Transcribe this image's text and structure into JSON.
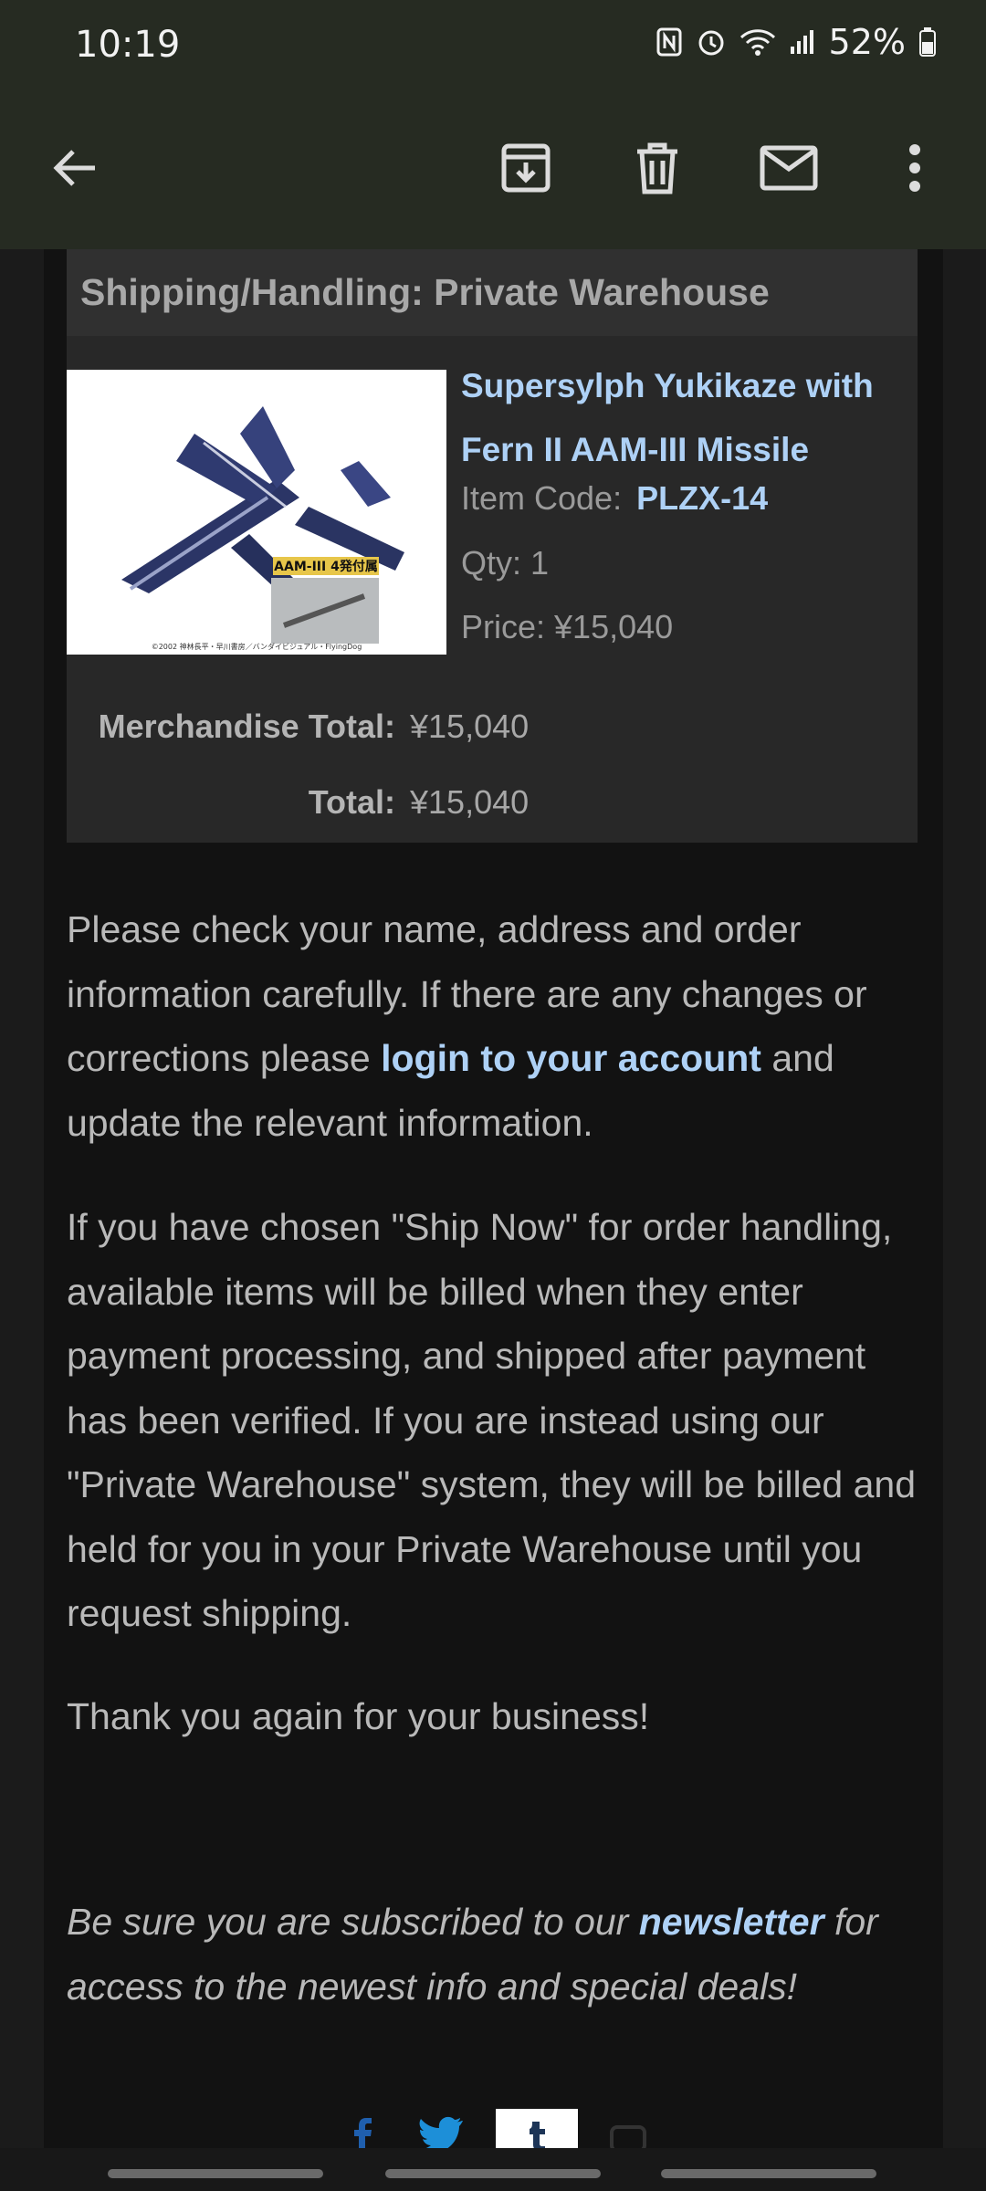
{
  "status": {
    "time": "10:19",
    "battery": "52%"
  },
  "toolbar": {
    "back_icon": "arrow-left-icon",
    "archive_icon": "archive-icon",
    "delete_icon": "trash-icon",
    "mail_icon": "mail-icon",
    "more_icon": "more-vert-icon"
  },
  "order": {
    "shipping_header": "Shipping/Handling: Private Warehouse",
    "product": {
      "name": "Supersylph Yukikaze with Fern II AAM-III Missile",
      "code_label": "Item Code:",
      "code": "PLZX-14",
      "qty": "Qty: 1",
      "price": "Price: ¥15,040",
      "image_badge": "AAM-III 4発付属",
      "image_caption": "©2002 神林長平・早川書房／バンダイビジュアル・FlyingDog"
    },
    "merch_total_label": "Merchandise Total:",
    "merch_total": "¥15,040",
    "total_label": "Total:",
    "total": "¥15,040"
  },
  "body": {
    "p1_a": "Please check your name, address and order information carefully. If there are any changes or corrections please ",
    "p1_link": "login to your account",
    "p1_b": " and update the relevant information.",
    "p2": "If you have chosen \"Ship Now\" for order handling, available items will be billed when they enter payment processing, and shipped after payment has been verified. If you are instead using our \"Private Warehouse\" system, they will be billed and held for you in your Private Warehouse until you request shipping.",
    "p3": "Thank you again for your business!",
    "p4_a": "Be sure you are subscribed to our ",
    "p4_link": "newsletter",
    "p4_b": " for access to the newest info and special deals!"
  },
  "colors": {
    "link": "#aed1f6",
    "appbar": "#262b22",
    "card": "#282828"
  }
}
